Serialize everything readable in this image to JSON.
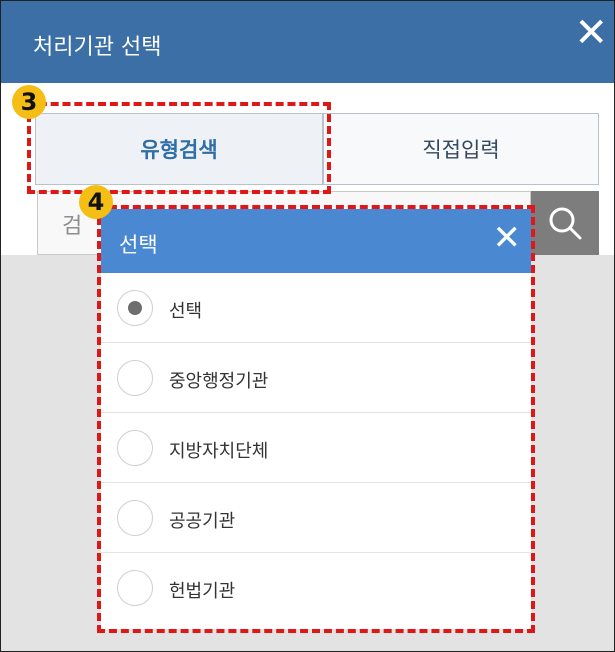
{
  "window": {
    "title": "처리기관 선택",
    "close_glyph": "✕"
  },
  "tabs": [
    {
      "label": "유형검색"
    },
    {
      "label": "직접입력"
    }
  ],
  "search": {
    "placeholder_visible": "검"
  },
  "modal": {
    "title": "선택",
    "close_glyph": "✕",
    "options": [
      {
        "label": "선택",
        "selected": true
      },
      {
        "label": "중앙행정기관",
        "selected": false
      },
      {
        "label": "지방자치단체",
        "selected": false
      },
      {
        "label": "공공기관",
        "selected": false
      },
      {
        "label": "헌법기관",
        "selected": false
      }
    ]
  },
  "badges": {
    "b3": "3",
    "b4": "4"
  },
  "colors": {
    "header": "#3b6fa6",
    "modal_header": "#4a89d1",
    "badge": "#f5be14",
    "highlight": "#e01717"
  },
  "icons": {
    "search": "search-icon"
  }
}
